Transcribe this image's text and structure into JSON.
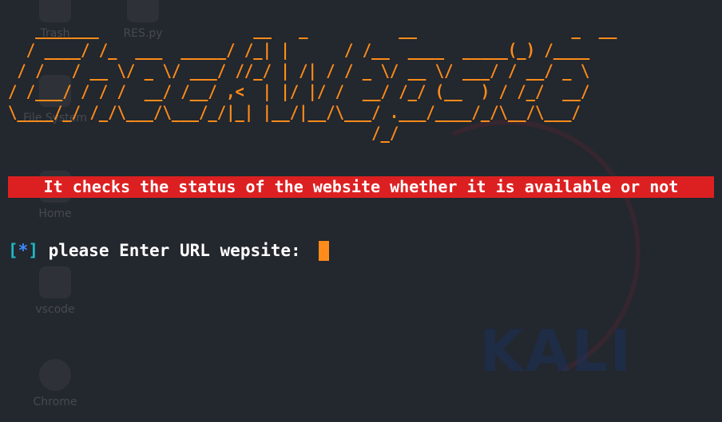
{
  "desktop": {
    "icons": [
      {
        "label": "Trash"
      },
      {
        "label": "RES.py"
      },
      {
        "label": "File System"
      },
      {
        "label": "Home"
      },
      {
        "label": "vscode"
      },
      {
        "label": "Chrome"
      }
    ],
    "watermark": "KALI"
  },
  "terminal": {
    "banner_lines": [
      "   _______                 __   _          __                 _  __",
      "  / ____/ /_  ___  _____/ /_| |      / /__  ____  _____(_) /____",
      " / /   / __ \\/ _ \\/ ___/ //_/ | /| / / _ \\/ __ \\/ ___/ / __/ _ \\",
      "/ /___/ / / /  __/ /__/ ,<  | |/ |/ /  __/ /_/ (__  ) / /_/  __/",
      "\\____/_/ /_/\\___/\\___/_/|_| |__/|__/\\___/ .___/____/_/\\__/\\___/",
      "                                        /_/"
    ],
    "subtitle": "It checks the status of the website whether it is available or not",
    "prompt": {
      "open_bracket": "[",
      "star": "*",
      "close_bracket": "]",
      "text": " please Enter URL wepsite: "
    },
    "colors": {
      "banner": "#ff8c1a",
      "subtitle_bg": "#dc2021",
      "bracket": "#1fb8c4",
      "star": "#3d8bff",
      "cursor": "#ff8c1a",
      "background": "#23272e"
    }
  }
}
